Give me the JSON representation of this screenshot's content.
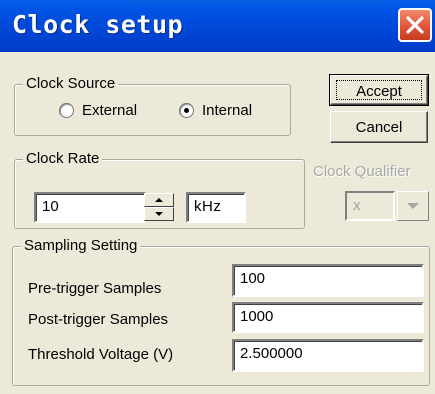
{
  "window": {
    "title": "Clock setup"
  },
  "clock_source": {
    "legend": "Clock Source",
    "options": [
      {
        "label": "External",
        "selected": false
      },
      {
        "label": "Internal",
        "selected": true
      }
    ]
  },
  "buttons": {
    "accept": "Accept",
    "cancel": "Cancel"
  },
  "clock_rate": {
    "legend": "Clock Rate",
    "value": "10",
    "unit": "kHz"
  },
  "clock_qualifier": {
    "label": "Clock Qualifier",
    "value": "x",
    "enabled": false
  },
  "sampling": {
    "legend": "Sampling Setting",
    "rows": [
      {
        "label": "Pre-trigger Samples",
        "value": "100"
      },
      {
        "label": "Post-trigger Samples",
        "value": "1000"
      },
      {
        "label": "Threshold Voltage (V)",
        "value": "2.500000"
      }
    ]
  },
  "icons": {
    "close": "close-icon",
    "spin_up": "spin-up-icon",
    "spin_down": "spin-down-icon",
    "dropdown": "chevron-down-icon"
  },
  "colors": {
    "titlebar": "#0055e5",
    "close_button": "#e0553a",
    "dialog_bg": "#ece9d8",
    "disabled_text": "#a8a8a8"
  }
}
